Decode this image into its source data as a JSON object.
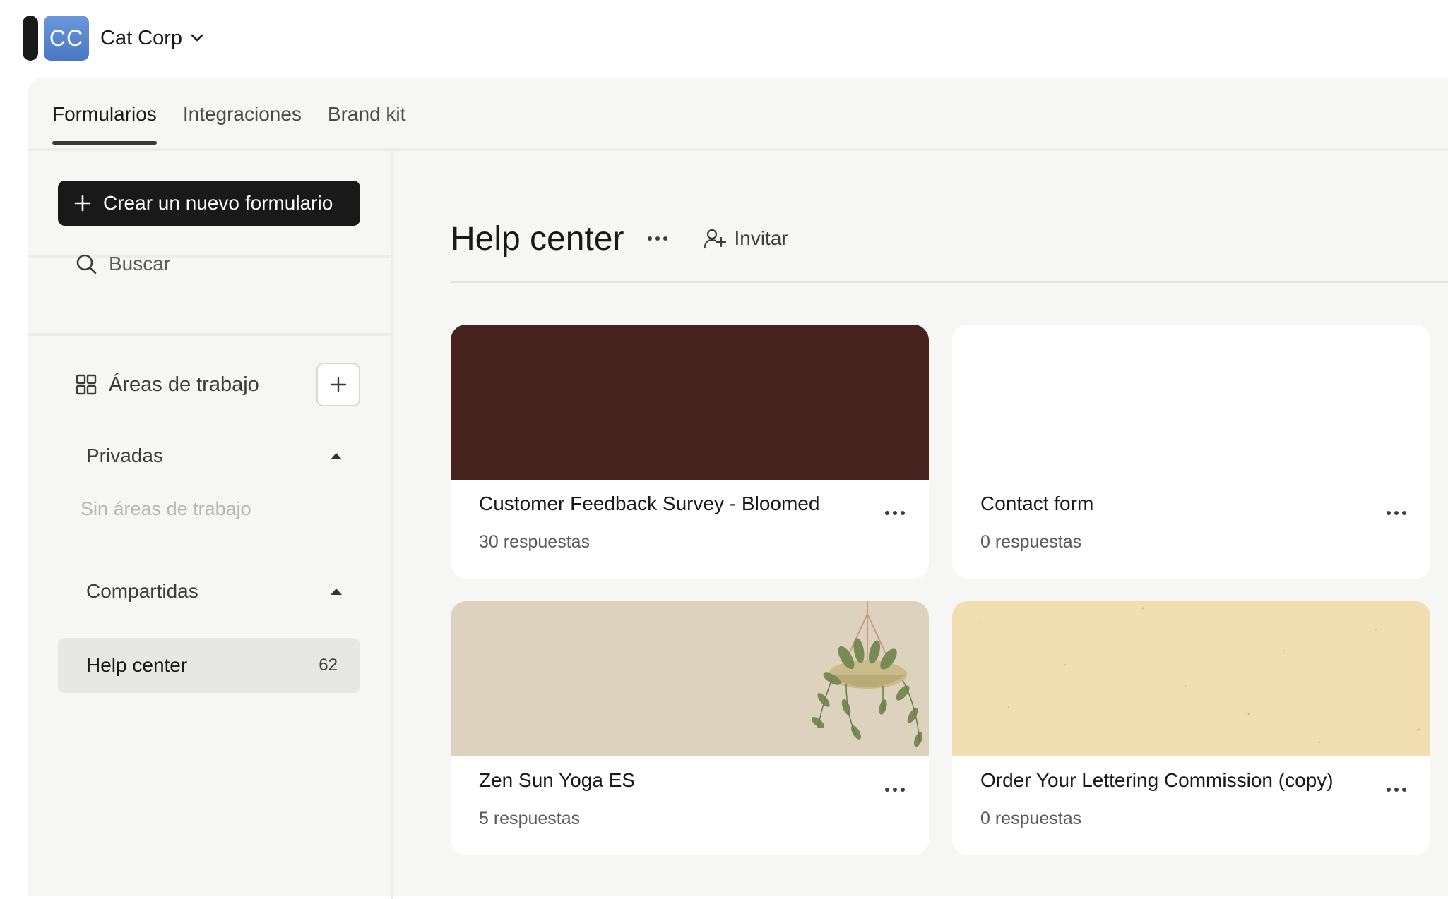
{
  "org": {
    "initials": "CC",
    "name": "Cat Corp"
  },
  "tabs": [
    {
      "label": "Formularios",
      "active": true
    },
    {
      "label": "Integraciones",
      "active": false
    },
    {
      "label": "Brand kit",
      "active": false
    }
  ],
  "sidebar": {
    "create_label": "Crear un nuevo formulario",
    "search_label": "Buscar",
    "workspaces_label": "Áreas de trabajo",
    "private_label": "Privadas",
    "empty_label": "Sin áreas de trabajo",
    "shared_label": "Compartidas",
    "items": [
      {
        "label": "Help center",
        "count": "62"
      }
    ]
  },
  "content": {
    "title": "Help center",
    "invite_label": "Invitar",
    "cards": [
      {
        "title": "Customer Feedback Survey - Bloomed",
        "responses": "30 respuestas",
        "cover": "#47231f"
      },
      {
        "title": "Contact form",
        "responses": "0 respuestas",
        "cover": "#ffffff"
      },
      {
        "title": "Zen Sun Yoga ES",
        "responses": "5 respuestas",
        "cover": "#ddd2bd"
      },
      {
        "title": "Order Your Lettering Commission (copy)",
        "responses": "0 respuestas",
        "cover": "#f1deb1"
      }
    ]
  },
  "colors": {
    "primary_button": "#191919",
    "panel_bg": "#f6f6f5",
    "active_item_bg": "#e7e7e5"
  }
}
